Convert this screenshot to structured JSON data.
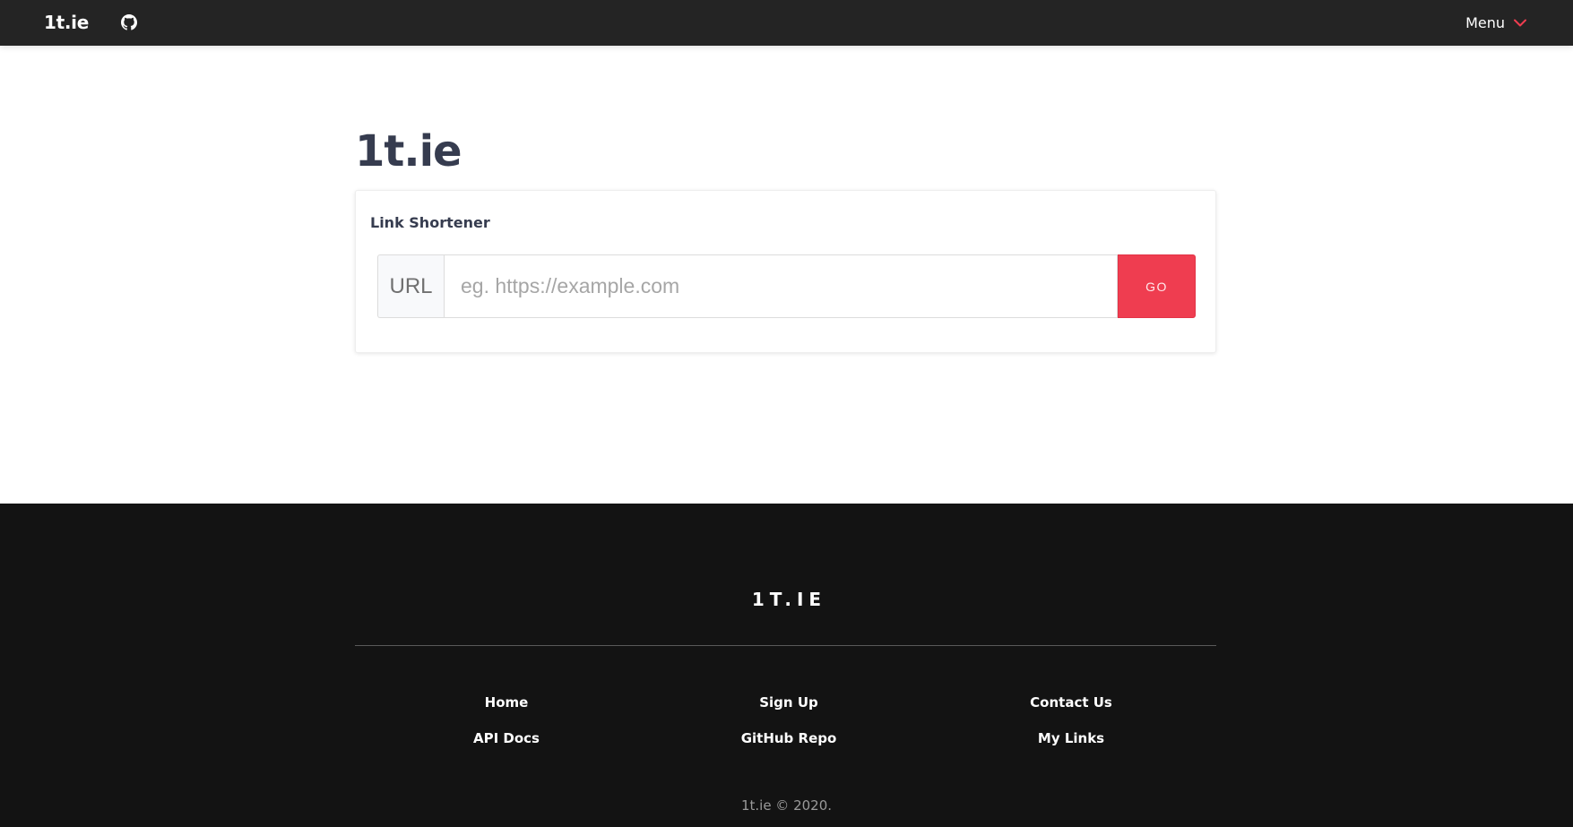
{
  "navbar": {
    "brand": "1t.ie",
    "github_icon": "github-icon",
    "menu_label": "Menu",
    "menu_icon": "chevron-down-icon",
    "accent_color": "#ef3d50"
  },
  "main": {
    "title": "1t.ie",
    "card": {
      "title": "Link Shortener",
      "addon_label": "URL",
      "input_placeholder": "eg. https://example.com",
      "input_value": "",
      "go_label": "GO"
    }
  },
  "footer": {
    "brand": "1T.IE",
    "links": [
      [
        "Home",
        "Sign Up",
        "Contact Us"
      ],
      [
        "API Docs",
        "GitHub Repo",
        "My Links"
      ]
    ],
    "copyright": "1t.ie © 2020."
  }
}
